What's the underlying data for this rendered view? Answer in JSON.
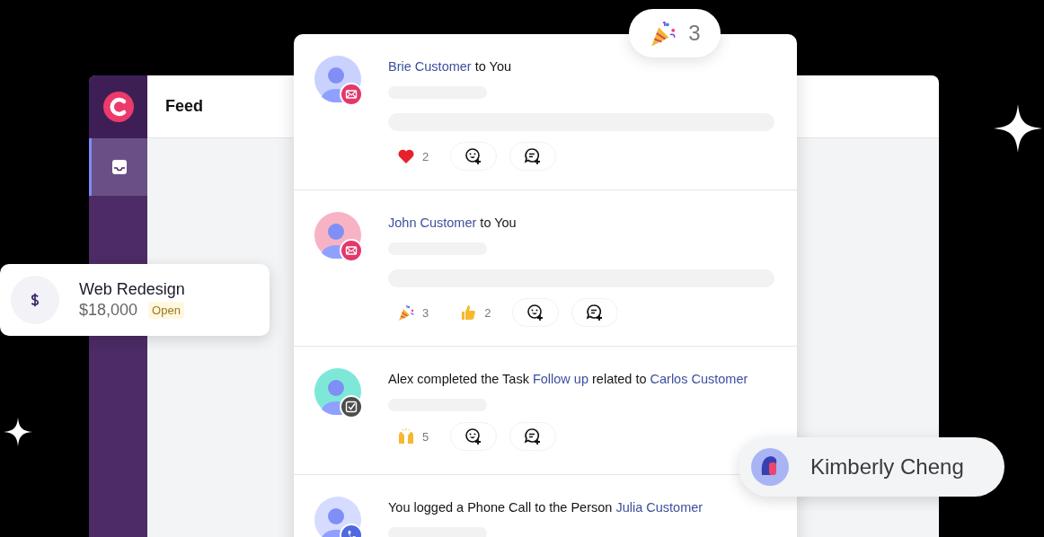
{
  "sidebar": {
    "items": [
      {
        "selected": true
      }
    ]
  },
  "header": {
    "title": "Feed"
  },
  "celebration": {
    "count": "3"
  },
  "feed": [
    {
      "color": "#c9d2ff",
      "kind": "email",
      "title": [
        {
          "text": "Brie Customer",
          "link": true
        },
        {
          "text": " to You",
          "link": false
        }
      ],
      "long_preview": true,
      "reactions": [
        {
          "kind": "heart",
          "count": "2"
        }
      ]
    },
    {
      "color": "#f7b3c4",
      "kind": "email",
      "title": [
        {
          "text": "John Customer",
          "link": true
        },
        {
          "text": " to You",
          "link": false
        }
      ],
      "long_preview": true,
      "reactions": [
        {
          "kind": "party",
          "count": "3"
        },
        {
          "kind": "thumbs",
          "count": "2"
        }
      ]
    },
    {
      "color": "#7ee8d8",
      "kind": "task",
      "title": [
        {
          "text": "Alex completed the Task ",
          "link": false
        },
        {
          "text": "Follow up",
          "link": true
        },
        {
          "text": " related to ",
          "link": false
        },
        {
          "text": "Carlos Customer",
          "link": true
        }
      ],
      "long_preview": false,
      "reactions": [
        {
          "kind": "hands",
          "count": "5"
        }
      ]
    },
    {
      "color": "#d6dcff",
      "kind": "phone",
      "title": [
        {
          "text": "You logged a Phone Call to the Person ",
          "link": false
        },
        {
          "text": "Julia Customer",
          "link": true
        }
      ],
      "long_preview": false
    }
  ],
  "deal": {
    "name": "Web Redesign",
    "amount": "$18,000",
    "status": "Open"
  },
  "person": {
    "name": "Kimberly Cheng"
  }
}
